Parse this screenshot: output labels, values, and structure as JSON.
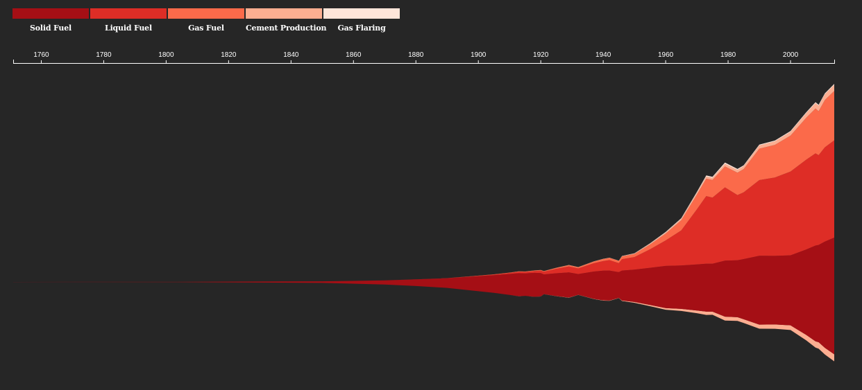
{
  "legend": {
    "items": [
      {
        "label": "Solid Fuel",
        "color": "#a50f15"
      },
      {
        "label": "Liquid Fuel",
        "color": "#de2d26"
      },
      {
        "label": "Gas Fuel",
        "color": "#fb6a4a"
      },
      {
        "label": "Cement Production",
        "color": "#fcae91"
      },
      {
        "label": "Gas Flaring",
        "color": "#fee5d9"
      }
    ]
  },
  "chart_data": {
    "type": "area",
    "layout": "streamgraph",
    "title": "",
    "xlabel": "",
    "ylabel": "",
    "xlim": [
      1751,
      2014
    ],
    "x_ticks": [
      1760,
      1780,
      1800,
      1820,
      1840,
      1860,
      1880,
      1900,
      1920,
      1940,
      1960,
      1980,
      2000
    ],
    "grid": false,
    "legend_position": "top-left",
    "x": [
      1751,
      1800,
      1850,
      1870,
      1880,
      1890,
      1900,
      1905,
      1910,
      1913,
      1915,
      1918,
      1920,
      1921,
      1925,
      1929,
      1932,
      1937,
      1940,
      1942,
      1945,
      1946,
      1950,
      1955,
      1960,
      1965,
      1970,
      1973,
      1975,
      1979,
      1983,
      1985,
      1990,
      1995,
      2000,
      2005,
      2008,
      2009,
      2011,
      2014
    ],
    "series": [
      {
        "name": "Solid Fuel",
        "values": [
          3,
          8,
          50,
          140,
          220,
          320,
          500,
          590,
          700,
          770,
          750,
          800,
          780,
          660,
          760,
          840,
          690,
          910,
          990,
          1000,
          860,
          1000,
          1080,
          1240,
          1410,
          1450,
          1540,
          1600,
          1600,
          1870,
          1900,
          2010,
          2300,
          2290,
          2340,
          2850,
          3200,
          3250,
          3550,
          3900
        ]
      },
      {
        "name": "Liquid Fuel",
        "values": [
          0,
          0,
          0,
          0,
          2,
          5,
          15,
          22,
          35,
          45,
          48,
          60,
          80,
          90,
          150,
          200,
          190,
          280,
          320,
          350,
          300,
          380,
          420,
          620,
          850,
          1170,
          1840,
          2260,
          2210,
          2450,
          2180,
          2230,
          2530,
          2620,
          2800,
          3000,
          3080,
          3000,
          3150,
          3250
        ]
      },
      {
        "name": "Gas Fuel",
        "values": [
          0,
          0,
          0,
          0,
          0,
          1,
          5,
          8,
          12,
          15,
          16,
          18,
          20,
          22,
          30,
          40,
          38,
          55,
          65,
          70,
          75,
          90,
          100,
          160,
          230,
          340,
          490,
          580,
          590,
          700,
          750,
          780,
          1050,
          1090,
          1200,
          1400,
          1500,
          1470,
          1580,
          1650
        ]
      },
      {
        "name": "Cement Production",
        "values": [
          0,
          0,
          0,
          0,
          0,
          0,
          0,
          0,
          2,
          4,
          4,
          5,
          5,
          6,
          10,
          15,
          12,
          18,
          20,
          22,
          18,
          25,
          35,
          50,
          70,
          90,
          120,
          140,
          140,
          170,
          180,
          190,
          210,
          230,
          250,
          300,
          350,
          360,
          380,
          400
        ]
      },
      {
        "name": "Gas Flaring",
        "values": [
          0,
          0,
          0,
          0,
          0,
          0,
          0,
          0,
          0,
          0,
          0,
          0,
          0,
          0,
          0,
          0,
          0,
          0,
          0,
          0,
          0,
          10,
          20,
          30,
          40,
          50,
          60,
          80,
          70,
          90,
          70,
          60,
          60,
          60,
          60,
          65,
          70,
          70,
          65,
          70
        ]
      }
    ]
  }
}
